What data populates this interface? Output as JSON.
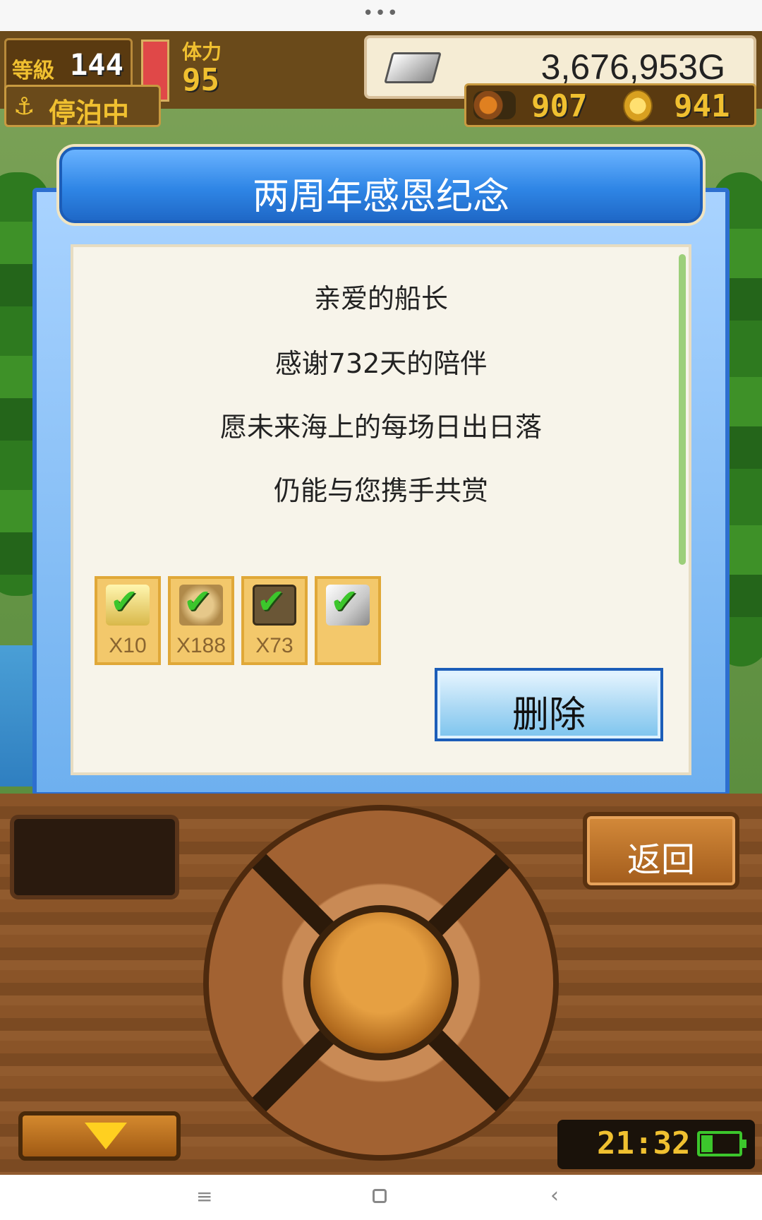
{
  "system": {
    "top_dots": "•••"
  },
  "hud": {
    "level_label": "等級",
    "level_value": "144",
    "level_progress": 0.28,
    "stamina_label": "体力",
    "stamina_value": "95",
    "stamina_fill": 1.0,
    "gold": "3,676,953G",
    "status": "停泊中",
    "resource1": "907",
    "resource2": "941"
  },
  "dialog": {
    "title": "两周年感恩纪念",
    "lines": [
      "亲爱的船长",
      "感谢732天的陪伴",
      "愿未来海上的每场日出日落",
      "仍能与您携手共赏"
    ],
    "items": [
      {
        "qty": "X10",
        "icon": "cake-icon"
      },
      {
        "qty": "X188",
        "icon": "food-icon"
      },
      {
        "qty": "X73",
        "icon": "box-icon"
      },
      {
        "qty": "",
        "icon": "ingot-icon"
      }
    ],
    "delete_label": "删除"
  },
  "controller": {
    "back_label": "返回",
    "clock": "21:32"
  },
  "colors": {
    "dialog_blue": "#2d6fcf",
    "gold_text": "#f0c030",
    "check_green": "#3cc62c"
  }
}
